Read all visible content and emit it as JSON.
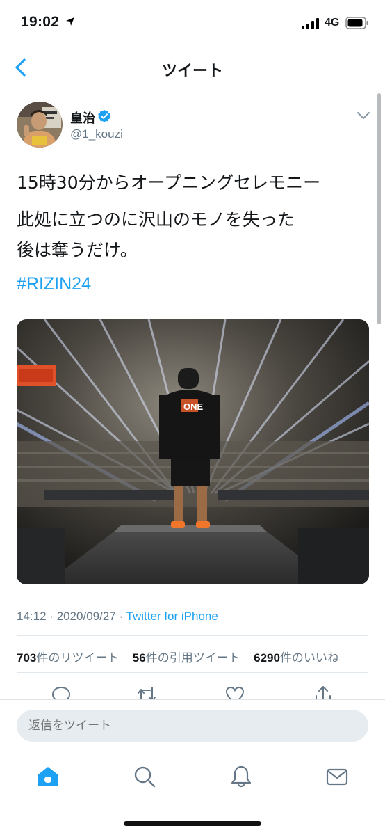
{
  "status_bar": {
    "time": "19:02",
    "network": "4G"
  },
  "nav": {
    "title": "ツイート"
  },
  "tweet": {
    "author_name": "皇治",
    "author_handle": "@1_kouzi",
    "lines": [
      "15時30分からオープニングセレモニー",
      "此処に立つのに沢山のモノを失った",
      "後は奪うだけ。"
    ],
    "hashtag": "#RIZIN24",
    "timestamp": "14:12 · 2020/09/27 · ",
    "client": "Twitter for iPhone",
    "stats": {
      "retweets_count": "703",
      "retweets_label": "件のリツイート",
      "quotes_count": "56",
      "quotes_label": "件の引用ツイート",
      "likes_count": "6290",
      "likes_label": "件のいいね"
    }
  },
  "reply": {
    "placeholder": "返信をツイート"
  },
  "colors": {
    "accent": "#1da1f2",
    "secondary_text": "#657786",
    "divider": "#e1e8ed"
  },
  "icons": {
    "status": [
      "location-arrow-icon",
      "signal-icon",
      "battery-icon"
    ],
    "actions": [
      "reply-icon",
      "retweet-icon",
      "like-icon",
      "share-icon"
    ],
    "tabs": [
      "home-icon",
      "search-icon",
      "notifications-icon",
      "messages-icon"
    ]
  }
}
